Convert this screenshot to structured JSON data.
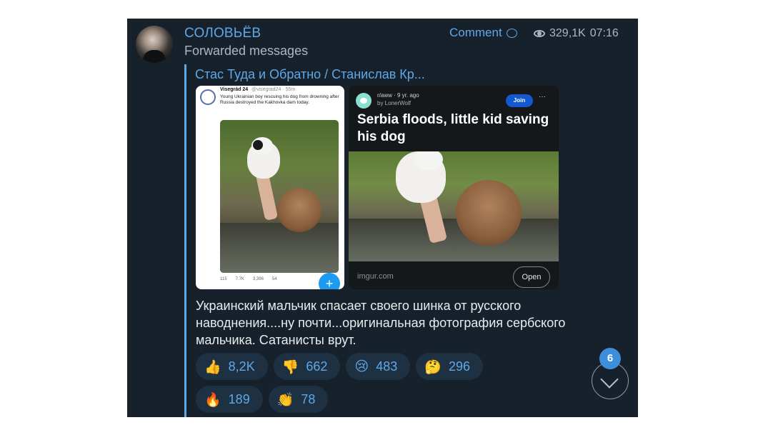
{
  "post": {
    "channel_name": "СОЛОВЬЁВ",
    "forwarded_label": "Forwarded messages",
    "comment_label": "Comment",
    "views": "329,1K",
    "time": "07:16",
    "quoted_author": "Стас Туда и Обратно / Станислав Кр...",
    "message": "Украинский мальчик спасает своего шинка от русского наводнения....ну почти...оригинальная фотография сербского мальчика. Сатанисты врут."
  },
  "tweet_image": {
    "account": "Visegrád 24",
    "handle": "@visegrad24 · 55m",
    "text": "Young Ukrainian boy rescuing his dog from drowning after Russia destroyed the Kakhovka dam today.",
    "actions": [
      "115",
      "7.7K",
      "3,396",
      "54"
    ],
    "fab_icon": "plus-icon"
  },
  "reddit_image": {
    "subreddit": "r/aww · 9 yr. ago",
    "by": "by LonerWolf",
    "join_label": "Join",
    "more_label": "···",
    "title": "Serbia floods, little kid saving his dog",
    "domain": "imgur.com",
    "open_label": "Open"
  },
  "reactions": [
    {
      "emoji": "👍",
      "icon": "thumbs-up-icon",
      "count": "8,2K"
    },
    {
      "emoji": "👎",
      "icon": "thumbs-down-icon",
      "count": "662"
    },
    {
      "emoji": "😢",
      "icon": "crying-face-icon",
      "count": "483"
    },
    {
      "emoji": "🤔",
      "icon": "thinking-face-icon",
      "count": "296"
    },
    {
      "emoji": "🔥",
      "icon": "fire-icon",
      "count": "189"
    },
    {
      "emoji": "👏",
      "icon": "clapping-hands-icon",
      "count": "78"
    }
  ],
  "scroll": {
    "unread_badge": "6"
  },
  "colors": {
    "panel_bg": "#17212b",
    "accent": "#5fa8e8",
    "reaction_bg": "#1e3142"
  }
}
